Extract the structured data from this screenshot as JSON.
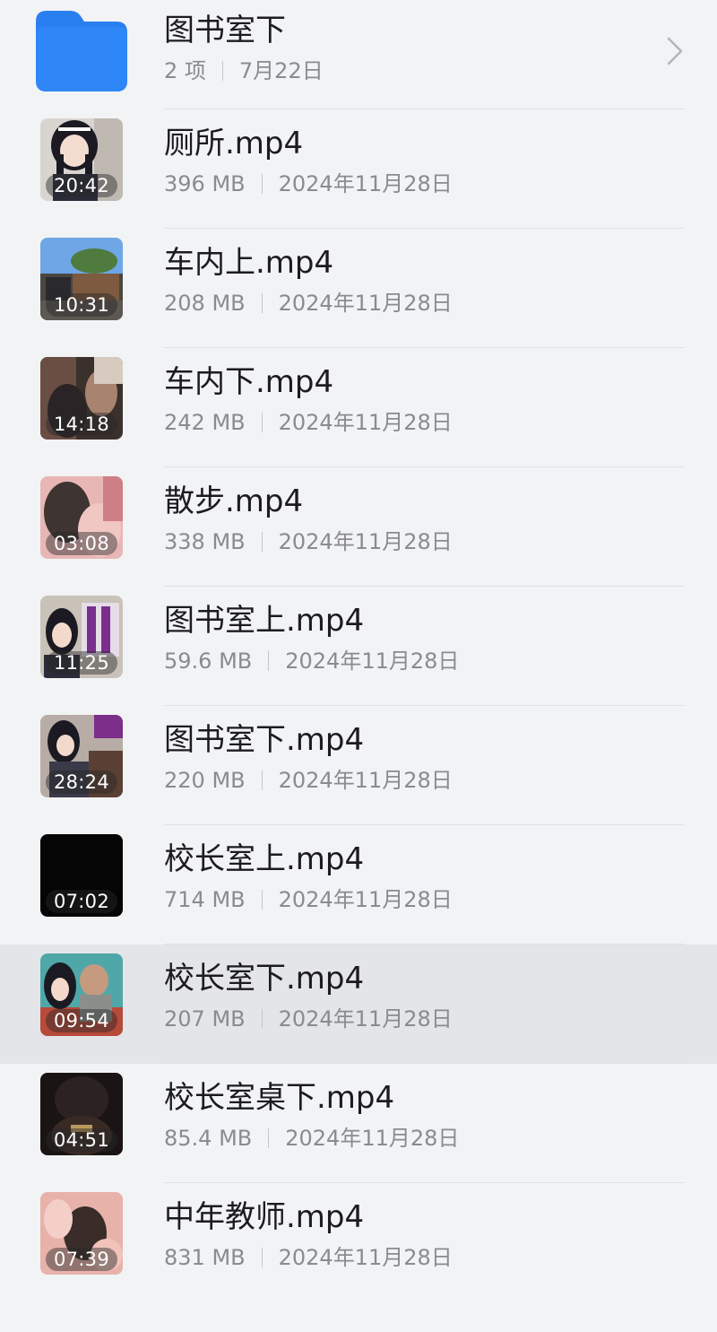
{
  "folder": {
    "name": "图书室下",
    "count": "2 项",
    "date": "7月22日",
    "icon": "folder-icon",
    "accent": "#2a7ff0"
  },
  "files": [
    {
      "name": "厕所.mp4",
      "size": "396 MB",
      "date": "2024年11月28日",
      "duration": "20:42",
      "thumb": "anime-girl-dark-hair"
    },
    {
      "name": "车内上.mp4",
      "size": "208 MB",
      "date": "2024年11月28日",
      "duration": "10:31",
      "thumb": "street-scene-sky"
    },
    {
      "name": "车内下.mp4",
      "size": "242 MB",
      "date": "2024年11月28日",
      "duration": "14:18",
      "thumb": "car-interior-dark"
    },
    {
      "name": "散步.mp4",
      "size": "338 MB",
      "date": "2024年11月28日",
      "duration": "03:08",
      "thumb": "pink-scene"
    },
    {
      "name": "图书室上.mp4",
      "size": "59.6 MB",
      "date": "2024年11月28日",
      "duration": "11:25",
      "thumb": "title-card-purple"
    },
    {
      "name": "图书室下.mp4",
      "size": "220 MB",
      "date": "2024年11月28日",
      "duration": "28:24",
      "thumb": "library-scene"
    },
    {
      "name": "校长室上.mp4",
      "size": "714 MB",
      "date": "2024年11月28日",
      "duration": "07:02",
      "thumb": "black-frame"
    },
    {
      "name": "校长室下.mp4",
      "size": "207 MB",
      "date": "2024年11月28日",
      "duration": "09:54",
      "thumb": "office-scene",
      "selected": true
    },
    {
      "name": "校长室桌下.mp4",
      "size": "85.4 MB",
      "date": "2024年11月28日",
      "duration": "04:51",
      "thumb": "dark-under-desk"
    },
    {
      "name": "中年教师.mp4",
      "size": "831 MB",
      "date": "2024年11月28日",
      "duration": "07:39",
      "thumb": "pink-close-up"
    }
  ],
  "colors": {
    "background": "#f2f3f5",
    "selected_row": "#e4e5e8",
    "title_text": "#1c1c1e",
    "meta_text": "#8a8b8f"
  }
}
